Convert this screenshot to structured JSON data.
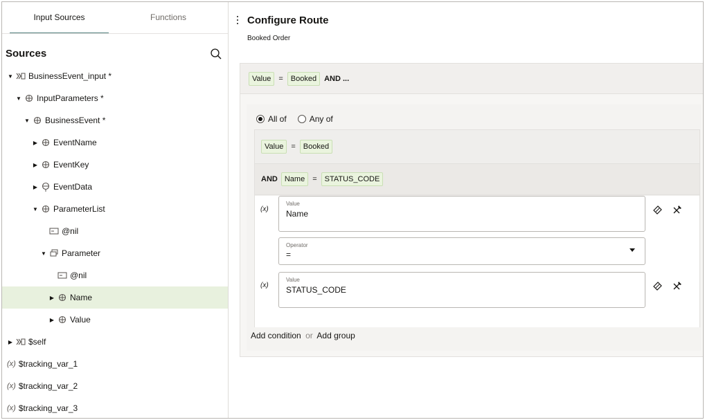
{
  "tabs": [
    {
      "label": "Input Sources",
      "active": true
    },
    {
      "label": "Functions",
      "active": false
    }
  ],
  "sources": {
    "title": "Sources",
    "tree": [
      {
        "label": "BusinessEvent_input *",
        "level": 0,
        "toggle": "expanded",
        "icon": "json-source-icon"
      },
      {
        "label": "InputParameters *",
        "level": 1,
        "toggle": "expanded",
        "icon": "element-icon"
      },
      {
        "label": "BusinessEvent *",
        "level": 2,
        "toggle": "expanded",
        "icon": "element-icon"
      },
      {
        "label": "EventName",
        "level": 3,
        "toggle": "collapsed",
        "icon": "element-icon"
      },
      {
        "label": "EventKey",
        "level": 3,
        "toggle": "collapsed",
        "icon": "element-icon"
      },
      {
        "label": "EventData",
        "level": 3,
        "toggle": "collapsed",
        "icon": "element-optional-icon"
      },
      {
        "label": "ParameterList",
        "level": 3,
        "toggle": "expanded",
        "icon": "element-icon"
      },
      {
        "label": "@nil",
        "level": 4,
        "toggle": "none",
        "icon": "attribute-icon"
      },
      {
        "label": "Parameter",
        "level": 4,
        "toggle": "expanded",
        "icon": "repeating-element-icon"
      },
      {
        "label": "@nil",
        "level": 5,
        "toggle": "none",
        "icon": "attribute-icon"
      },
      {
        "label": "Name",
        "level": 5,
        "toggle": "collapsed",
        "icon": "element-icon",
        "selected": true
      },
      {
        "label": "Value",
        "level": 5,
        "toggle": "collapsed",
        "icon": "element-icon"
      },
      {
        "label": "$self",
        "level": 0,
        "toggle": "collapsed",
        "icon": "json-source-icon"
      },
      {
        "label": "$tracking_var_1",
        "level": 0,
        "toggle": "none",
        "icon": "variable-icon"
      },
      {
        "label": "$tracking_var_2",
        "level": 0,
        "toggle": "none",
        "icon": "variable-icon"
      },
      {
        "label": "$tracking_var_3",
        "level": 0,
        "toggle": "none",
        "icon": "variable-icon"
      }
    ]
  },
  "route": {
    "title": "Configure Route",
    "subtitle": "Booked Order"
  },
  "summary": {
    "left": "Value",
    "op": "=",
    "right": "Booked",
    "suffix": "AND ..."
  },
  "match": {
    "all_label": "All of",
    "any_label": "Any of",
    "selected": "all"
  },
  "conditions": [
    {
      "prefix": "",
      "left": "Value",
      "op": "=",
      "right": "Booked"
    },
    {
      "prefix": "AND",
      "left": "Name",
      "op": "=",
      "right": "STATUS_CODE"
    }
  ],
  "editor": {
    "x_marker": "(x)",
    "left_field": {
      "label": "Value",
      "value": "Name"
    },
    "operator_field": {
      "label": "Operator",
      "value": "="
    },
    "right_field": {
      "label": "Value",
      "value": "STATUS_CODE"
    }
  },
  "footer": {
    "add_condition": "Add condition",
    "or": "or",
    "add_group": "Add group"
  },
  "colors": {
    "selected_row": "#e8f1de",
    "chip_bg": "#eaf4de",
    "chip_border": "#c9dfb4",
    "tab_accent": "#4f7d7b"
  }
}
